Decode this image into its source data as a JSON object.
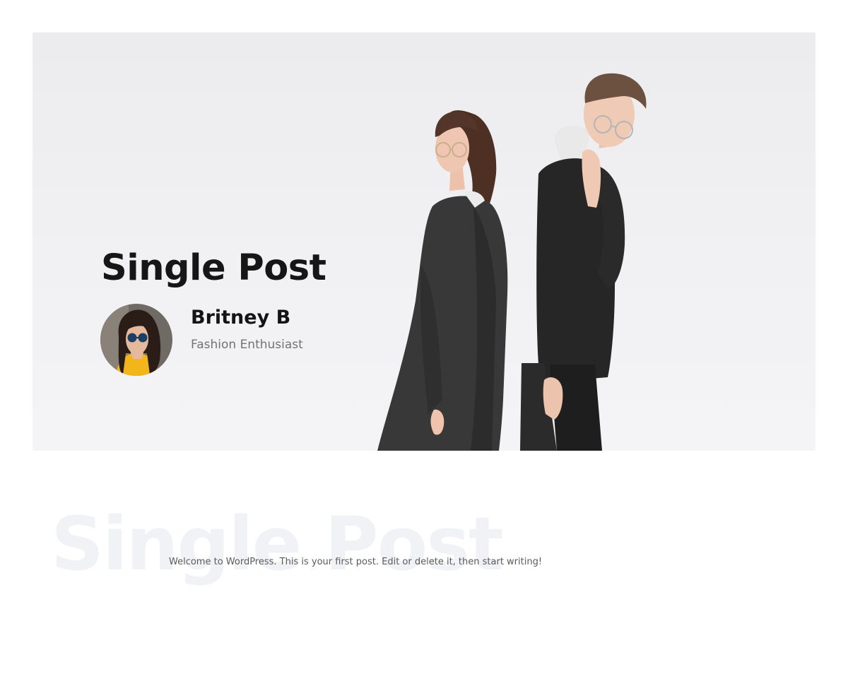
{
  "hero": {
    "title": "Single Post",
    "image": "fashion-couple-photo"
  },
  "author": {
    "name": "Britney B",
    "role": "Fashion Enthusiast",
    "avatar_icon": "author-avatar-photo"
  },
  "content": {
    "watermark": "Single Post",
    "body": "Welcome to WordPress. This is your first post. Edit or delete it, then start writing!"
  },
  "colors": {
    "hero_background": "#efeff1",
    "heading": "#161616",
    "muted_text": "#737373",
    "watermark": "#f1f2f5"
  }
}
